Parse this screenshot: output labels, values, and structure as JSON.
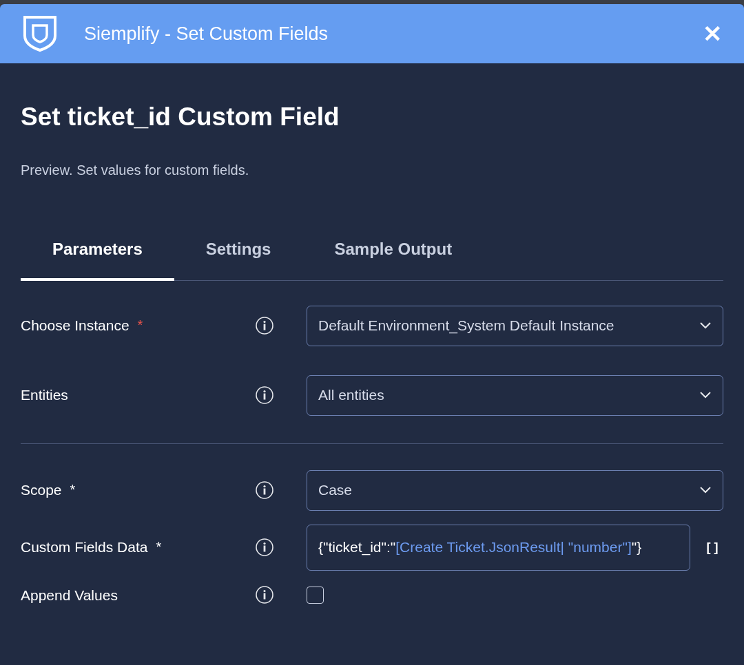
{
  "window": {
    "title": "Siemplify - Set Custom Fields",
    "close": "✕"
  },
  "heading": "Set ticket_id Custom Field",
  "description": "Preview. Set values for custom fields.",
  "tabs": [
    {
      "label": "Parameters",
      "selected": true
    },
    {
      "label": "Settings",
      "selected": false
    },
    {
      "label": "Sample Output",
      "selected": false
    }
  ],
  "sections": [
    {
      "fields": [
        {
          "kind": "dropdown",
          "label": "Choose Instance",
          "asterisk": "*",
          "color": "#e5534b",
          "value": "Default Environment_System Default Instance"
        },
        {
          "kind": "dropdown",
          "label": "Entities",
          "value": "All entities"
        }
      ]
    },
    {
      "fields": [
        {
          "kind": "dropdown",
          "label": "Scope",
          "asterisk": "*",
          "color": "#ffffff",
          "value": "Case"
        },
        {
          "kind": "text",
          "label": "Custom Fields Data",
          "asterisk": "*",
          "color": "#ffffff",
          "value_parts": [
            {
              "kind": "plain",
              "text": "{\"ticket_id\":\""
            },
            {
              "kind": "placeholder",
              "text": "[Create Ticket.JsonResult| \"number\"]"
            },
            {
              "kind": "plain",
              "text": "\"}"
            }
          ],
          "insert_button": "[ ]"
        },
        {
          "kind": "checkbox",
          "label": "Append Values",
          "checked": false
        }
      ]
    }
  ]
}
